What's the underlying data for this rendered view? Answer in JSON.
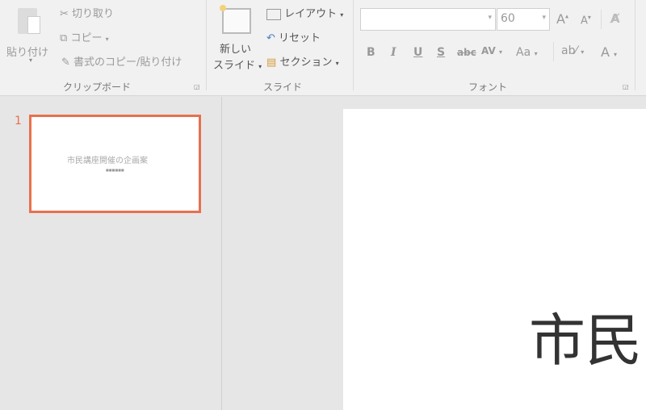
{
  "clipboard": {
    "paste": "貼り付け",
    "cut": "切り取り",
    "copy": "コピー",
    "format_painter": "書式のコピー/貼り付け",
    "group_label": "クリップボード"
  },
  "slides_group": {
    "new_slide_line1": "新しい",
    "new_slide_line2": "スライド",
    "layout": "レイアウト",
    "reset": "リセット",
    "section": "セクション",
    "group_label": "スライド"
  },
  "font": {
    "font_name": "",
    "font_size": "60",
    "bold": "B",
    "italic": "I",
    "underline": "U",
    "shadow": "S",
    "strikethrough": "abc",
    "spacing": "AV",
    "case": "Aa",
    "color": "A",
    "grow": "A",
    "shrink": "A",
    "group_label": "フォント"
  },
  "thumbnails": [
    {
      "number": "1",
      "title": "市民講座開催の企画案",
      "subtitle": "■■■■■■"
    }
  ],
  "slide": {
    "title_visible": "市民"
  },
  "colors": {
    "accent": "#e8704e"
  }
}
